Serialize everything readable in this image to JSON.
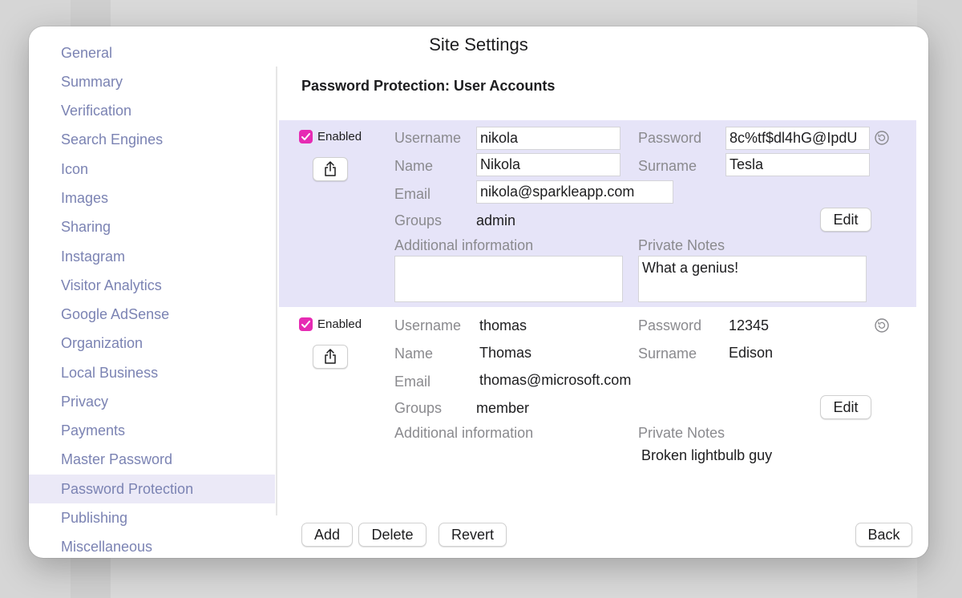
{
  "window": {
    "title": "Site Settings"
  },
  "sidebar": {
    "items": [
      {
        "label": "General"
      },
      {
        "label": "Summary"
      },
      {
        "label": "Verification"
      },
      {
        "label": "Search Engines"
      },
      {
        "label": "Icon"
      },
      {
        "label": "Images"
      },
      {
        "label": "Sharing"
      },
      {
        "label": "Instagram"
      },
      {
        "label": "Visitor Analytics"
      },
      {
        "label": "Google AdSense"
      },
      {
        "label": "Organization"
      },
      {
        "label": "Local Business"
      },
      {
        "label": "Privacy"
      },
      {
        "label": "Payments"
      },
      {
        "label": "Master Password"
      },
      {
        "label": "Password Protection",
        "active": true
      },
      {
        "label": "Publishing"
      },
      {
        "label": "Miscellaneous"
      }
    ]
  },
  "main": {
    "title": "Password Protection: User Accounts",
    "labels": {
      "enabled": "Enabled",
      "username": "Username",
      "password": "Password",
      "name": "Name",
      "surname": "Surname",
      "email": "Email",
      "groups": "Groups",
      "additional": "Additional information",
      "notes": "Private Notes",
      "edit": "Edit"
    },
    "accounts": [
      {
        "enabled": true,
        "username": "nikola",
        "password": "8c%tf$dl4hG@IpdU",
        "name": "Nikola",
        "surname": "Tesla",
        "email": "nikola@sparkleapp.com",
        "groups": "admin",
        "additional": "",
        "notes": "What a genius!"
      },
      {
        "enabled": true,
        "username": "thomas",
        "password": "12345",
        "name": "Thomas",
        "surname": "Edison",
        "email": "thomas@microsoft.com",
        "groups": "member",
        "additional": "",
        "notes": "Broken lightbulb guy"
      }
    ]
  },
  "footer": {
    "add": "Add",
    "delete": "Delete",
    "revert": "Revert",
    "back": "Back"
  },
  "colors": {
    "accent": "#e62bb3",
    "sidebar_text": "#7b83b3",
    "selection": "#e6e4f8"
  },
  "icons": {
    "share": "share-icon",
    "reset": "reset-icon",
    "check": "checkmark-icon"
  }
}
